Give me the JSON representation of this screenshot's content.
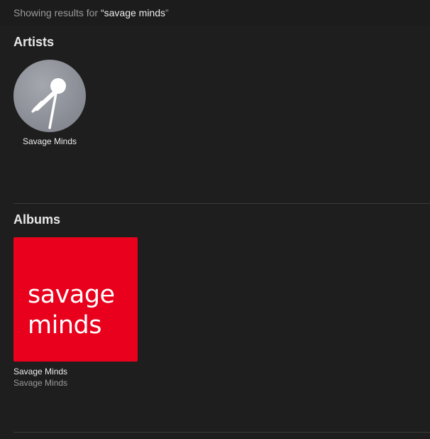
{
  "results": {
    "prefix": "Showing results for ",
    "open_quote": "“",
    "query": "savage minds",
    "close_quote": "”"
  },
  "artists": {
    "heading": "Artists",
    "items": [
      {
        "name": "Savage Minds",
        "icon": "microphone-icon"
      }
    ]
  },
  "albums": {
    "heading": "Albums",
    "items": [
      {
        "title": "Savage Minds",
        "artist": "Savage Minds",
        "artwork_lines": [
          "savage",
          "minds"
        ],
        "artwork_color": "#e8001c"
      }
    ]
  },
  "colors": {
    "background": "#1e1e1e",
    "artwork_red": "#e8001c",
    "secondary_text": "#9a9a9a"
  }
}
